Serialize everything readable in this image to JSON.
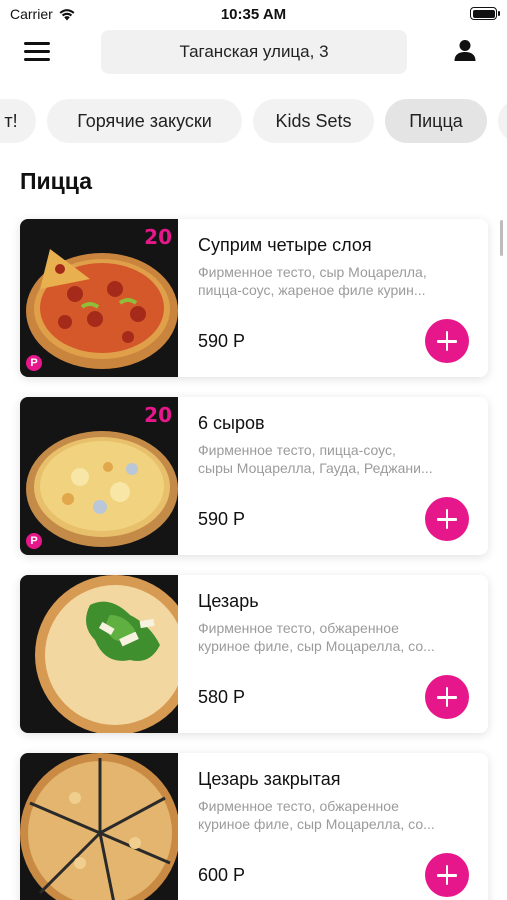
{
  "status_bar": {
    "carrier": "Carrier",
    "time": "10:35 AM",
    "battery_level": 1.0
  },
  "header": {
    "menu_icon": "hamburger-menu-icon",
    "address": "Таганская улица, 3",
    "profile_icon": "user-profile-icon"
  },
  "categories": [
    {
      "label": "т!",
      "active": false
    },
    {
      "label": "Горячие закуски",
      "active": false
    },
    {
      "label": "Kids Sets",
      "active": false
    },
    {
      "label": "Пицца",
      "active": true
    }
  ],
  "section": {
    "title": "Пицца"
  },
  "products": [
    {
      "name": "Суприм четыре слоя",
      "desc_line1": "Фирменное тесто, сыр Моцарелла,",
      "desc_line2": "пицца-соус, жареное филе курин...",
      "price": "590 Р",
      "badge": "20",
      "logo": "P"
    },
    {
      "name": "6 сыров",
      "desc_line1": "Фирменное тесто, пицца-соус,",
      "desc_line2": "сыры Моцарелла, Гауда, Реджани...",
      "price": "590 Р",
      "badge": "20",
      "logo": "P"
    },
    {
      "name": "Цезарь",
      "desc_line1": "Фирменное тесто, обжаренное",
      "desc_line2": "куриное филе, сыр Моцарелла, со...",
      "price": "580 Р"
    },
    {
      "name": "Цезарь закрытая",
      "desc_line1": "Фирменное тесто, обжаренное",
      "desc_line2": "куриное филе, сыр Моцарелла, со...",
      "price": "600 Р"
    }
  ],
  "colors": {
    "accent": "#e6178b",
    "chip_bg": "#f2f2f2",
    "chip_active_bg": "#e4e4e4",
    "desc_text": "#9b9b9b"
  }
}
